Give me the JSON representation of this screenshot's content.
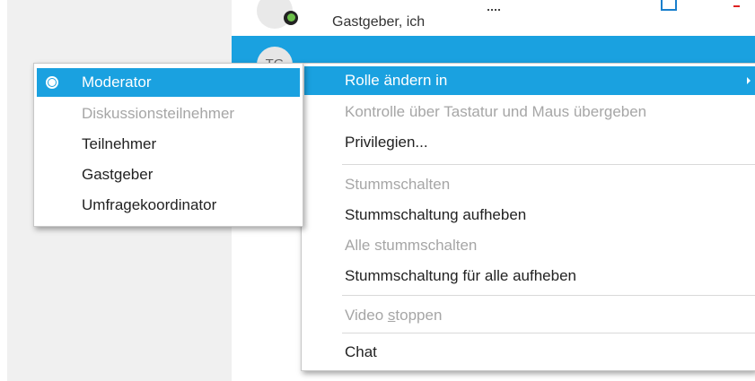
{
  "participants": {
    "row1": {
      "name": "Gastgeber, ich"
    },
    "row2": {
      "avatar_initials": "TG"
    }
  },
  "context_menu": {
    "items": [
      {
        "label": "Rolle ändern in",
        "state": "highlighted",
        "has_submenu": true
      },
      {
        "label": "Kontrolle über Tastatur und Maus übergeben",
        "state": "disabled"
      },
      {
        "label": "Privilegien...",
        "state": "enabled"
      },
      {
        "label": "Stummschalten",
        "state": "disabled"
      },
      {
        "label": "Stummschaltung aufheben",
        "state": "enabled"
      },
      {
        "label": "Alle stummschalten",
        "state": "disabled"
      },
      {
        "label": "Stummschaltung für alle aufheben",
        "state": "enabled"
      },
      {
        "label_pre": "Video ",
        "label_accel": "s",
        "label_post": "toppen",
        "state": "disabled"
      },
      {
        "label": "Chat",
        "state": "enabled"
      }
    ]
  },
  "role_submenu": {
    "items": [
      {
        "label": "Moderator",
        "state": "highlighted",
        "selected": true
      },
      {
        "label": "Diskussionsteilnehmer",
        "state": "disabled"
      },
      {
        "label": "Teilnehmer",
        "state": "enabled"
      },
      {
        "label": "Gastgeber",
        "state": "enabled"
      },
      {
        "label": "Umfragekoordinator",
        "state": "enabled"
      }
    ]
  },
  "colors": {
    "highlight": "#1aa1e0",
    "disabled_text": "#a6a6a6",
    "left_pane": "#f0f0f0"
  },
  "icons": {
    "selected_role": "radio-selected-icon",
    "submenu_arrow": "chevron-right-icon",
    "presence": "status-icon"
  }
}
